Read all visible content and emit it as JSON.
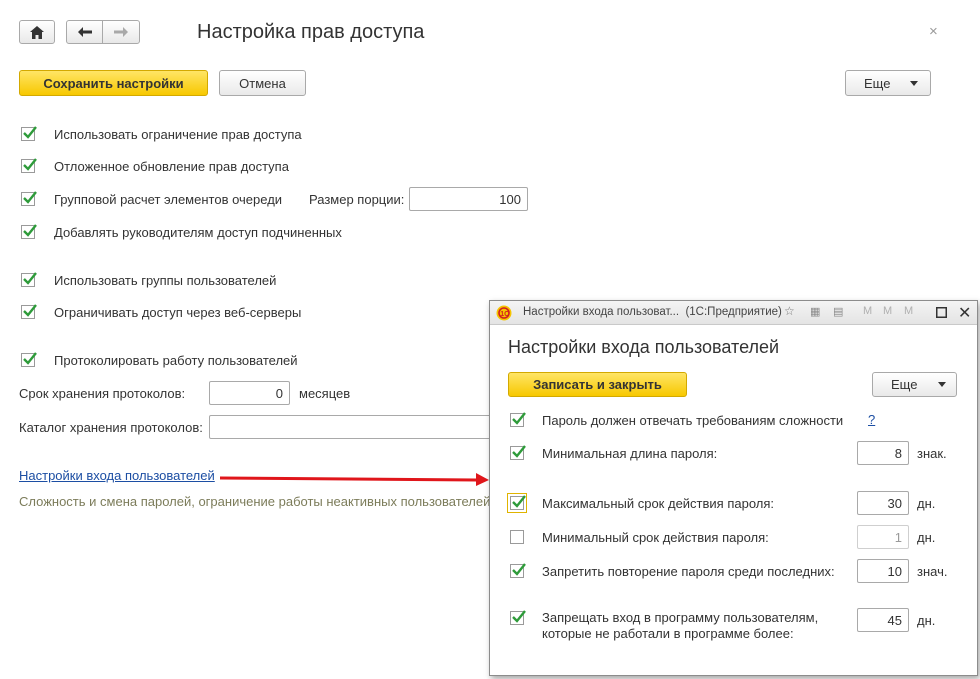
{
  "main": {
    "title": "Настройка прав доступа",
    "save_label": "Сохранить настройки",
    "cancel_label": "Отмена",
    "more_label": "Еще",
    "options": {
      "use_restriction": "Использовать ограничение прав доступа",
      "deferred_update": "Отложенное обновление прав доступа",
      "group_calc": "Групповой расчет элементов очереди",
      "portion_size_label": "Размер порции:",
      "portion_size_value": "100",
      "add_managers": "Добавлять руководителям доступ подчиненных",
      "user_groups": "Использовать группы пользователей",
      "web_servers": "Ограничивать доступ через веб-серверы",
      "log_work": "Протоколировать работу пользователей",
      "log_retention_label": "Срок хранения протоколов:",
      "log_retention_value": "0",
      "log_retention_unit": "месяцев",
      "log_catalog_label": "Каталог хранения протоколов:",
      "log_catalog_value": ""
    },
    "login_settings_link": "Настройки входа пользователей",
    "login_settings_hint": "Сложность и смена паролей, ограничение работы неактивных пользователей."
  },
  "dialog": {
    "window_title": "Настройки входа пользоват...  (1С:Предприятие)",
    "title": "Настройки входа пользователей",
    "save_close_label": "Записать и закрыть",
    "more_label": "Еще",
    "help_label": "?",
    "rows": {
      "complexity": "Пароль должен отвечать требованиям сложности",
      "min_length": "Минимальная длина пароля:",
      "min_length_value": "8",
      "min_length_unit": "знак.",
      "max_age": "Максимальный срок действия пароля:",
      "max_age_value": "30",
      "max_age_unit": "дн.",
      "min_age": "Минимальный срок действия пароля:",
      "min_age_value": "1",
      "min_age_unit": "дн.",
      "no_repeat": "Запретить повторение пароля среди последних:",
      "no_repeat_value": "10",
      "no_repeat_unit": "знач.",
      "inactive_line1": "Запрещать вход в программу пользователям,",
      "inactive_line2": "которые не работали в программе более:",
      "inactive_value": "45",
      "inactive_unit": "дн."
    },
    "checked": {
      "complexity": true,
      "min_length": true,
      "max_age": true,
      "min_age": false,
      "no_repeat": true,
      "inactive": true
    }
  },
  "colors": {
    "accent_yellow": "#f7c800",
    "check_green": "#2e9b3a",
    "link_blue": "#1c4ea3",
    "arrow_red": "#e0161b"
  },
  "icons": [
    "home-icon",
    "back-arrow-icon",
    "forward-arrow-icon",
    "close-icon",
    "app-1c-icon",
    "star-icon",
    "calculator-icon",
    "calendar-icon",
    "maximize-icon"
  ]
}
